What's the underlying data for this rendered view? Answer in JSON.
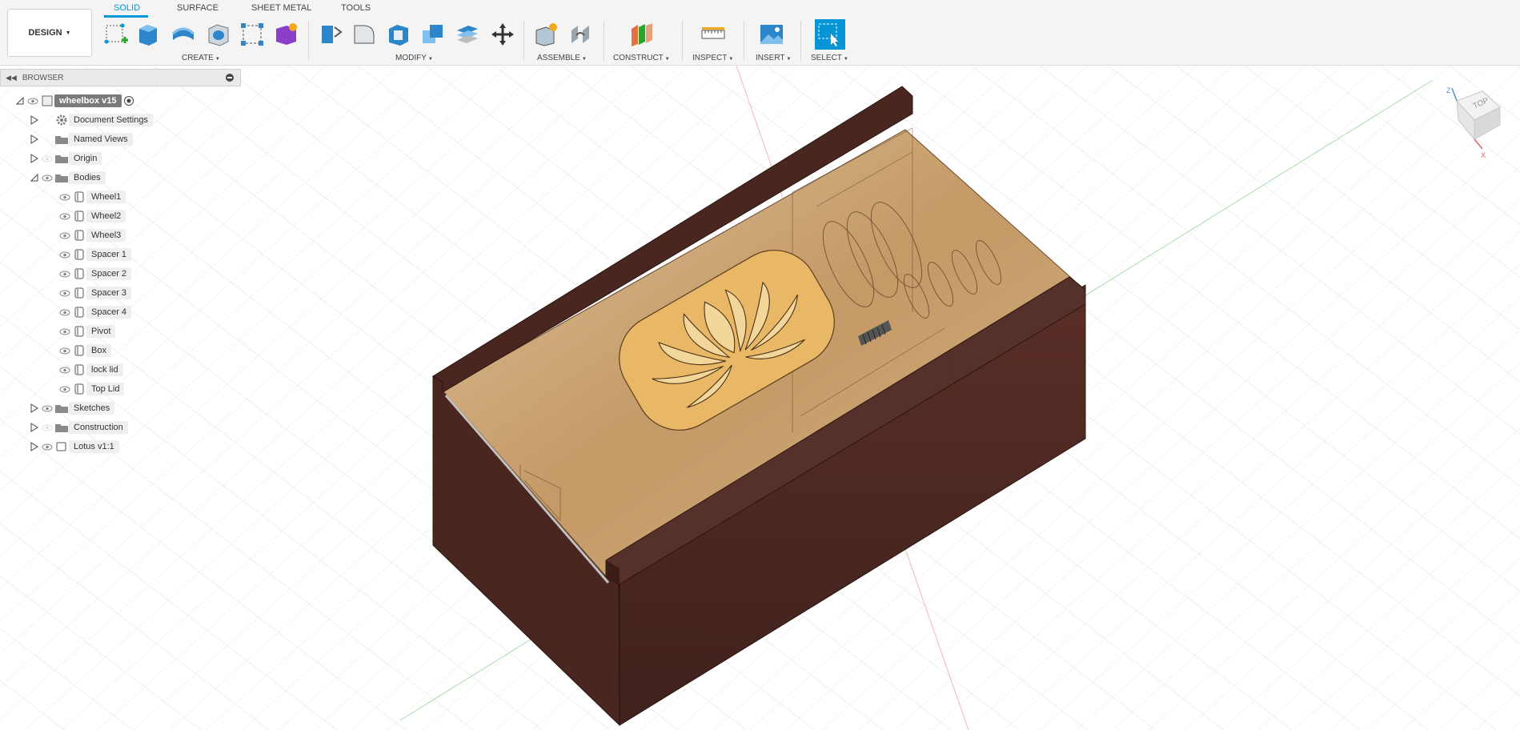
{
  "toolbar": {
    "design_label": "DESIGN",
    "tabs": [
      "SOLID",
      "SURFACE",
      "SHEET METAL",
      "TOOLS"
    ],
    "groups": {
      "create": "CREATE",
      "modify": "MODIFY",
      "assemble": "ASSEMBLE",
      "construct": "CONSTRUCT",
      "inspect": "INSPECT",
      "insert": "INSERT",
      "select": "SELECT"
    }
  },
  "browser": {
    "title": "BROWSER",
    "root": "wheelbox v15",
    "items": [
      {
        "label": "Document Settings"
      },
      {
        "label": "Named Views"
      },
      {
        "label": "Origin"
      },
      {
        "label": "Bodies"
      },
      {
        "label": "Wheel1"
      },
      {
        "label": "Wheel2"
      },
      {
        "label": "Wheel3"
      },
      {
        "label": "Spacer 1"
      },
      {
        "label": "Spacer 2"
      },
      {
        "label": "Spacer 3"
      },
      {
        "label": "Spacer 4"
      },
      {
        "label": "Pivot"
      },
      {
        "label": "Box"
      },
      {
        "label": "lock lid"
      },
      {
        "label": "Top Lid"
      },
      {
        "label": "Sketches"
      },
      {
        "label": "Construction"
      },
      {
        "label": "Lotus v1:1"
      }
    ]
  },
  "viewcube": {
    "face": "TOP",
    "axis_z": "Z",
    "axis_x": "X"
  },
  "colors": {
    "accent": "#0696d7",
    "wood_dark": "#4a2620",
    "wood_light": "#c9a270",
    "lotus": "#e6b96a"
  }
}
